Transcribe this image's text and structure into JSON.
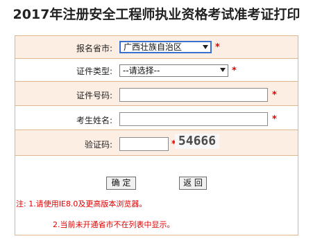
{
  "page": {
    "title": "2017年注册安全工程师执业资格考试准考证打印"
  },
  "form": {
    "province": {
      "label": "报名省市:",
      "value": "广西壮族自治区",
      "required": "*"
    },
    "id_type": {
      "label": "证件类型:",
      "value": "--请选择--",
      "required": "*"
    },
    "id_number": {
      "label": "证件号码:",
      "value": "",
      "required": "*"
    },
    "name": {
      "label": "考生姓名:",
      "value": "",
      "required": "*"
    },
    "captcha": {
      "label": "验证码:",
      "value": "",
      "required": "*",
      "image_text": "54666"
    },
    "buttons": {
      "confirm": "确 定",
      "back": "返 回"
    }
  },
  "notes": {
    "line1": "注: 1.请使用IE8.0及更高版本浏览器。",
    "line2": "2.当前未开通省市不在列表中显示。"
  },
  "colors": {
    "border": "#e0b48c",
    "row_alt": "#fdeee4",
    "required": "#e00000",
    "focus": "#3a6fd0"
  }
}
